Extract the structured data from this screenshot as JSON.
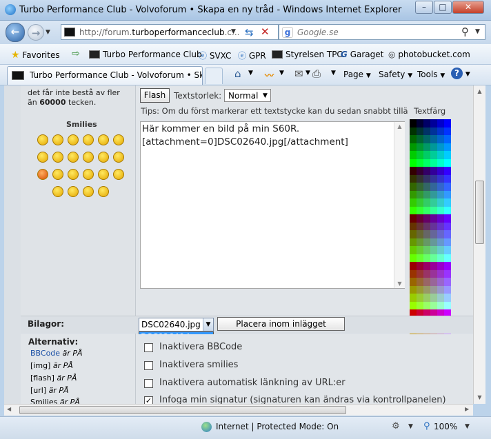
{
  "window": {
    "title": "Turbo Performance Club - Volvoforum • Skapa en ny tråd - Windows Internet Explorer",
    "minimize": "–",
    "maximize": "□",
    "close": "✕"
  },
  "address_bar": {
    "url_prefix": "http://forum.",
    "url_domain": "turboperformanceclub",
    "url_suffix": ".c...",
    "search_placeholder": "Google.se"
  },
  "favorites": {
    "label": "Favorites",
    "items": [
      "Turbo Performance Club",
      "SVXC",
      "GPR",
      "Styrelsen TPC",
      "Garaget",
      "photobucket.com"
    ]
  },
  "tab": {
    "label": "Turbo Performance Club - Volvoforum • Skap..."
  },
  "commands": {
    "page": "Page",
    "safety": "Safety",
    "tools": "Tools",
    "help": "?"
  },
  "left": {
    "limit_text_1": "det får inte bestå av fler",
    "limit_text_2a": "än ",
    "limit_text_2b": "60000",
    "limit_text_2c": " tecken.",
    "smilies_heading": "Smilies"
  },
  "toolbar": {
    "flash_button": "Flash",
    "fontsize_label": "Textstorlek:",
    "fontsize_value": "Normal",
    "tip": "Tips: Om du först markerar ett textstycke kan du sedan snabbt tillä",
    "color_label": "Textfärg"
  },
  "editor": {
    "line1": "Här kommer en bild på min S60R.",
    "line2": "[attachment=0]DSC02640.jpg[/attachment]"
  },
  "attachments": {
    "label": "Bilagor:",
    "select_value": "DSC02640.jpg",
    "dropdown_option": "DSC02640.jpg",
    "place_button": "Placera inom inlägget"
  },
  "options": {
    "heading": "Alternativ:",
    "status": [
      {
        "name": "BBCode",
        "rest": " är PÅ"
      },
      {
        "name": "[img]",
        "rest": " är PÅ"
      },
      {
        "name": "[flash]",
        "rest": " är PÅ"
      },
      {
        "name": "[url]",
        "rest": " är PÅ"
      },
      {
        "name": "Smilies",
        "rest": " är PÅ"
      }
    ],
    "checkboxes": [
      {
        "label": "Inaktivera BBCode",
        "checked": false
      },
      {
        "label": "Inaktivera smilies",
        "checked": false
      },
      {
        "label": "Inaktivera automatisk länkning av URL:er",
        "checked": false
      },
      {
        "label": "Infoga min signatur (signaturen kan ändras via kontrollpanelen)",
        "checked": true
      }
    ]
  },
  "status_bar": {
    "zone": "Internet | Protected Mode: On",
    "zoom": "100%"
  }
}
